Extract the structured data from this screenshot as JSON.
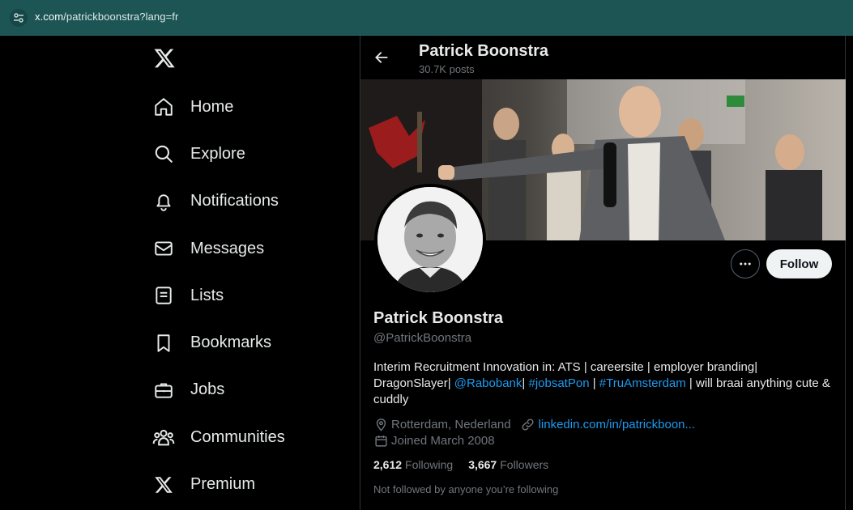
{
  "browser": {
    "url_host": "x.com",
    "url_path": "/patrickboonstra?lang=fr",
    "site_info_icon": "tune-icon"
  },
  "nav": {
    "logo": "x-logo",
    "items": [
      {
        "label": "Home",
        "icon": "home-icon"
      },
      {
        "label": "Explore",
        "icon": "search-icon"
      },
      {
        "label": "Notifications",
        "icon": "bell-icon"
      },
      {
        "label": "Messages",
        "icon": "envelope-icon"
      },
      {
        "label": "Lists",
        "icon": "list-icon"
      },
      {
        "label": "Bookmarks",
        "icon": "bookmark-icon"
      },
      {
        "label": "Jobs",
        "icon": "briefcase-icon"
      },
      {
        "label": "Communities",
        "icon": "people-icon"
      },
      {
        "label": "Premium",
        "icon": "x-icon"
      }
    ]
  },
  "header": {
    "name": "Patrick Boonstra",
    "posts": "30.7K posts"
  },
  "profile": {
    "name": "Patrick Boonstra",
    "handle": "@PatrickBoonstra",
    "follow_label": "Follow",
    "bio": {
      "part1": "Interim Recruitment Innovation in: ATS | careersite | employer branding| DragonSlayer| ",
      "mention": "@Rabobank",
      "part2": "| ",
      "hashtag1": "#jobsatPon",
      "part3": " | ",
      "hashtag2": "#TruAmsterdam",
      "part4": " | will braai anything cute & cuddly"
    },
    "location": "Rotterdam, Nederland",
    "website": "linkedin.com/in/patrickboon...",
    "joined": "Joined March 2008",
    "following_count": "2,612",
    "following_label": "Following",
    "followers_count": "3,667",
    "followers_label": "Followers",
    "not_followed": "Not followed by anyone you’re following"
  },
  "colors": {
    "accent": "#1d9bf0",
    "muted": "#71767b",
    "addressbar": "#1d5454"
  }
}
